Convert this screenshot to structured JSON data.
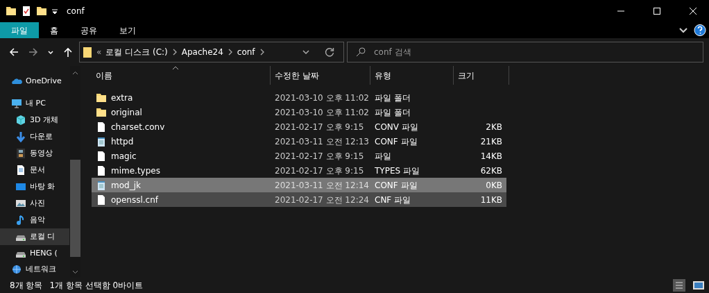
{
  "window": {
    "title": "conf"
  },
  "ribbon_tabs": [
    {
      "label": "파일",
      "selected": true
    },
    {
      "label": "홈",
      "selected": false
    },
    {
      "label": "공유",
      "selected": false
    },
    {
      "label": "보기",
      "selected": false
    }
  ],
  "address": {
    "overflow": "«",
    "path": [
      "로컬 디스크 (C:)",
      "Apache24",
      "conf"
    ]
  },
  "search": {
    "placeholder": "conf 검색"
  },
  "sidebar": {
    "items": [
      {
        "label": "OneDrive",
        "kind": "cloud",
        "selected": false
      },
      {
        "label": "내 PC",
        "kind": "pc",
        "selected": false,
        "children": [
          {
            "label": "3D 개체",
            "kind": "cube",
            "selected": false
          },
          {
            "label": "다운로",
            "kind": "download",
            "selected": false
          },
          {
            "label": "동영상",
            "kind": "video",
            "selected": false
          },
          {
            "label": "문서",
            "kind": "document",
            "selected": false
          },
          {
            "label": "바탕 화",
            "kind": "desktop",
            "selected": false
          },
          {
            "label": "사진",
            "kind": "photo",
            "selected": false
          },
          {
            "label": "음악",
            "kind": "music",
            "selected": false
          },
          {
            "label": "로컬 디",
            "kind": "drive",
            "selected": true
          },
          {
            "label": "HENG (",
            "kind": "drive",
            "selected": false
          }
        ]
      },
      {
        "label": "네트워크",
        "kind": "network",
        "selected": false
      }
    ]
  },
  "table": {
    "columns": [
      "이름",
      "수정한 날짜",
      "유형",
      "크기"
    ],
    "rows": [
      {
        "name": "extra",
        "kind": "folder",
        "date": "2021-03-10 오후 11:02",
        "type": "파일 폴더",
        "selected": false,
        "hovered": false
      },
      {
        "name": "original",
        "kind": "folder",
        "date": "2021-03-10 오후 11:02",
        "type": "파일 폴더",
        "selected": false,
        "hovered": false
      },
      {
        "name": "charset.conv",
        "kind": "file",
        "date": "2021-02-17 오후 9:15",
        "type": "CONV 파일",
        "size": "2KB",
        "selected": false,
        "hovered": false
      },
      {
        "name": "httpd",
        "kind": "notepad",
        "date": "2021-03-11 오전 12:13",
        "type": "CONF 파일",
        "size": "21KB",
        "selected": false,
        "hovered": false
      },
      {
        "name": "magic",
        "kind": "file",
        "date": "2021-02-17 오후 9:15",
        "type": "파일",
        "size": "14KB",
        "selected": false,
        "hovered": false
      },
      {
        "name": "mime.types",
        "kind": "file",
        "date": "2021-02-17 오후 9:15",
        "type": "TYPES 파일",
        "size": "62KB",
        "selected": false,
        "hovered": false
      },
      {
        "name": "mod_jk",
        "kind": "notepad",
        "date": "2021-03-11 오전 12:14",
        "type": "CONF 파일",
        "size": "0KB",
        "selected": true,
        "hovered": false
      },
      {
        "name": "openssl.cnf",
        "kind": "file",
        "date": "2021-02-17 오전 12:24",
        "type": "CNF 파일",
        "size": "11KB",
        "selected": false,
        "hovered": true
      }
    ]
  },
  "status_bar": {
    "count": "8개 항목",
    "selection": "1개 항목 선택함 0바이트"
  }
}
